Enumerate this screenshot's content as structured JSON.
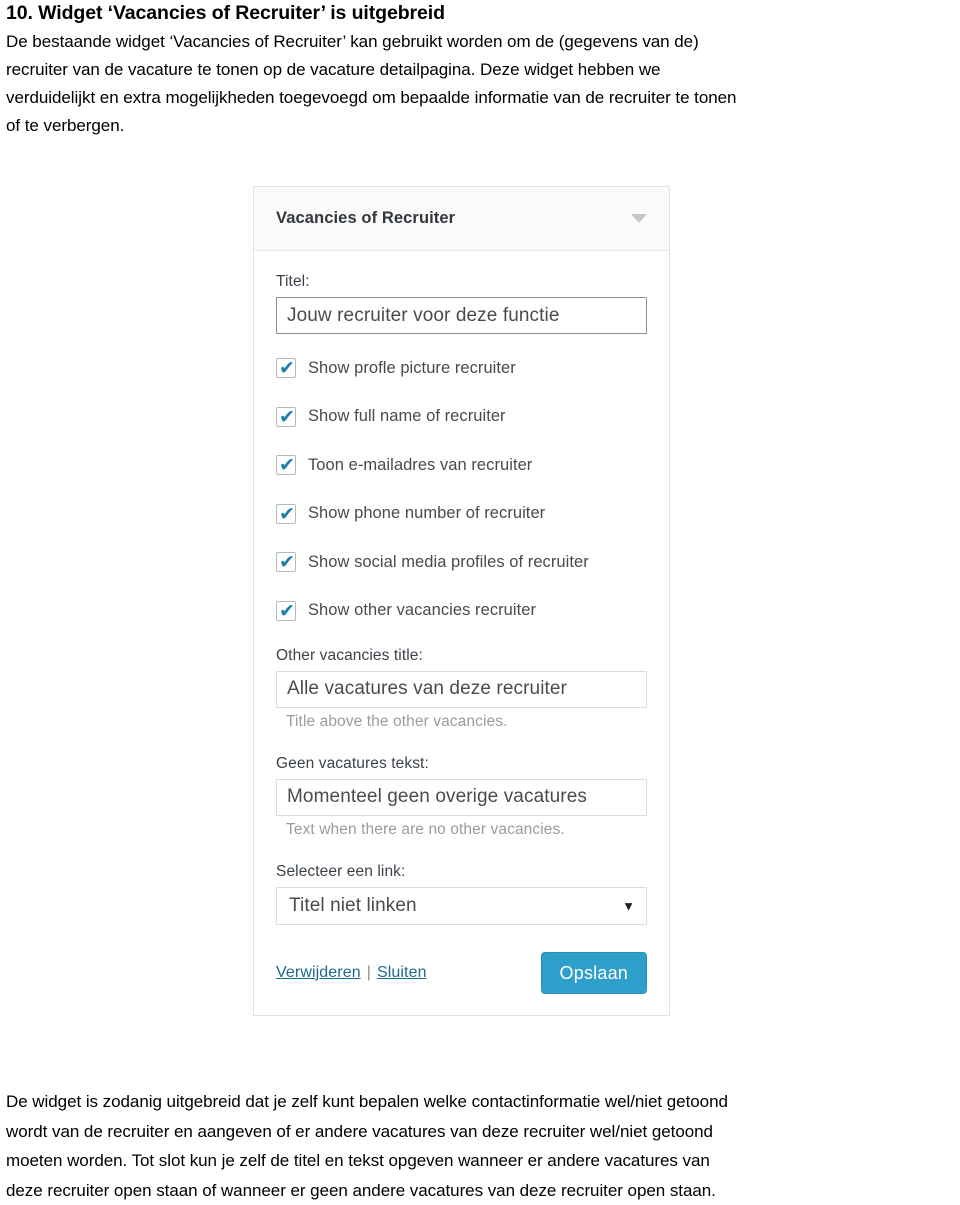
{
  "document": {
    "heading": "10. Widget ‘Vacancies of Recruiter’ is uitgebreid",
    "intro_lines": [
      "De bestaande widget ‘Vacancies of Recruiter’ kan gebruikt worden om de (gegevens van de)",
      "recruiter van de vacature te tonen op de vacature detailpagina. Deze widget hebben we",
      "verduidelijkt en extra mogelijkheden toegevoegd om bepaalde informatie van de recruiter te tonen",
      "of te verbergen."
    ],
    "closing_lines": [
      "De widget is zodanig uitgebreid dat je zelf kunt bepalen welke contactinformatie wel/niet getoond",
      "wordt van de recruiter en aangeven of er andere vacatures van deze recruiter wel/niet getoond",
      "moeten worden. Tot slot kun je zelf de titel en tekst opgeven wanneer er andere vacatures van",
      "deze recruiter open staan of wanneer er geen andere vacatures van deze recruiter open staan."
    ]
  },
  "widget": {
    "header": {
      "title": "Vacancies of Recruiter",
      "toggle_icon": "chevron-down-icon"
    },
    "title_field": {
      "label": "Titel:",
      "value": "Jouw recruiter voor deze functie"
    },
    "checkboxes": [
      {
        "label": "Show profle picture recruiter",
        "checked": true,
        "mark": "✔"
      },
      {
        "label": "Show full name of recruiter",
        "checked": true,
        "mark": "✔"
      },
      {
        "label": "Toon e-mailadres van recruiter",
        "checked": true,
        "mark": "✔"
      },
      {
        "label": "Show phone number of recruiter",
        "checked": true,
        "mark": "✔"
      },
      {
        "label": "Show social media profiles of recruiter",
        "checked": true,
        "mark": "✔"
      },
      {
        "label": "Show other vacancies recruiter",
        "checked": true,
        "mark": "✔"
      }
    ],
    "other_vacancies_title": {
      "label": "Other vacancies title:",
      "value": "Alle vacatures van deze recruiter",
      "help": "Title above the other vacancies."
    },
    "no_vacancies_text": {
      "label": "Geen vacatures tekst:",
      "value": "Momenteel geen overige vacatures",
      "help": "Text when there are no other vacancies."
    },
    "link_select": {
      "label": "Selecteer een link:",
      "value": "Titel niet linken",
      "arrow_icon": "▼"
    },
    "footer": {
      "delete_label": "Verwijderen",
      "separator": "|",
      "close_label": "Sluiten",
      "save_label": "Opslaan"
    },
    "colors": {
      "accent": "#2e9ecb",
      "link": "#1b6a8c",
      "checkmark": "#1e7fae",
      "header_bg": "#fafafa",
      "panel_border": "#e3e3e3"
    }
  }
}
